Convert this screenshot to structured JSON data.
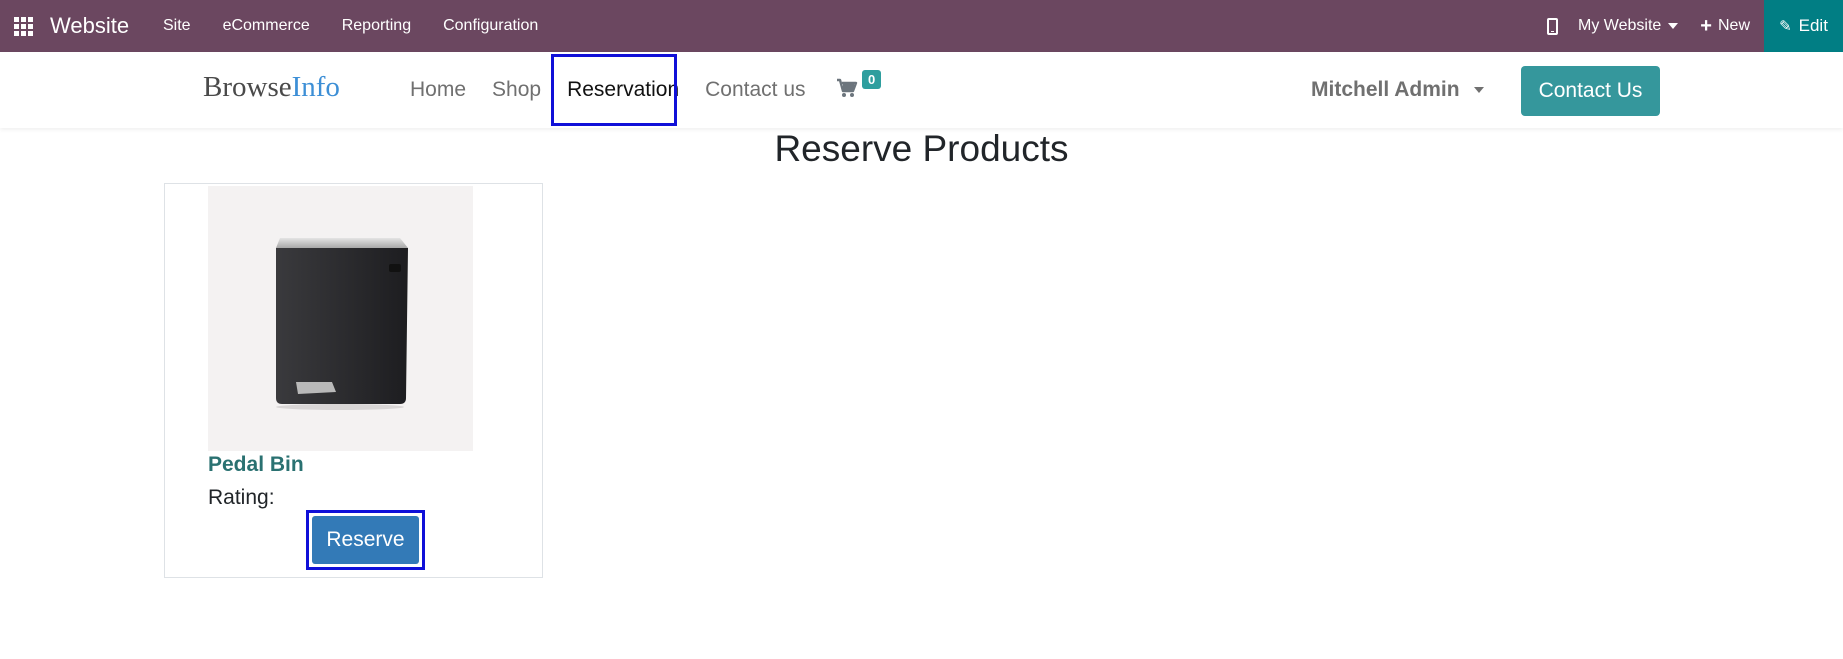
{
  "topbar": {
    "apps_icon": "grid-apps-icon",
    "brand": "Website",
    "menu": [
      "Site",
      "eCommerce",
      "Reporting",
      "Configuration"
    ],
    "mobile_icon": "mobile-phone-icon",
    "site_selector": "My Website",
    "new_label": "New",
    "edit_label": "Edit",
    "bar_color": "#6b4760",
    "edit_color": "#017e84"
  },
  "header": {
    "logo_part1": "Browse",
    "logo_part2": "Info",
    "nav": [
      "Home",
      "Shop",
      "Reservation",
      "Contact us"
    ],
    "active_nav": "Reservation",
    "cart_icon": "shopping-cart-icon",
    "cart_count": "0",
    "user_name": "Mitchell Admin",
    "contact_button": "Contact Us",
    "accent_color": "#35979c"
  },
  "main": {
    "title": "Reserve Products",
    "products": [
      {
        "name": "Pedal Bin",
        "rating_label": "Rating:",
        "button_label": "Reserve",
        "image_icon": "pedal-bin-image"
      }
    ]
  }
}
